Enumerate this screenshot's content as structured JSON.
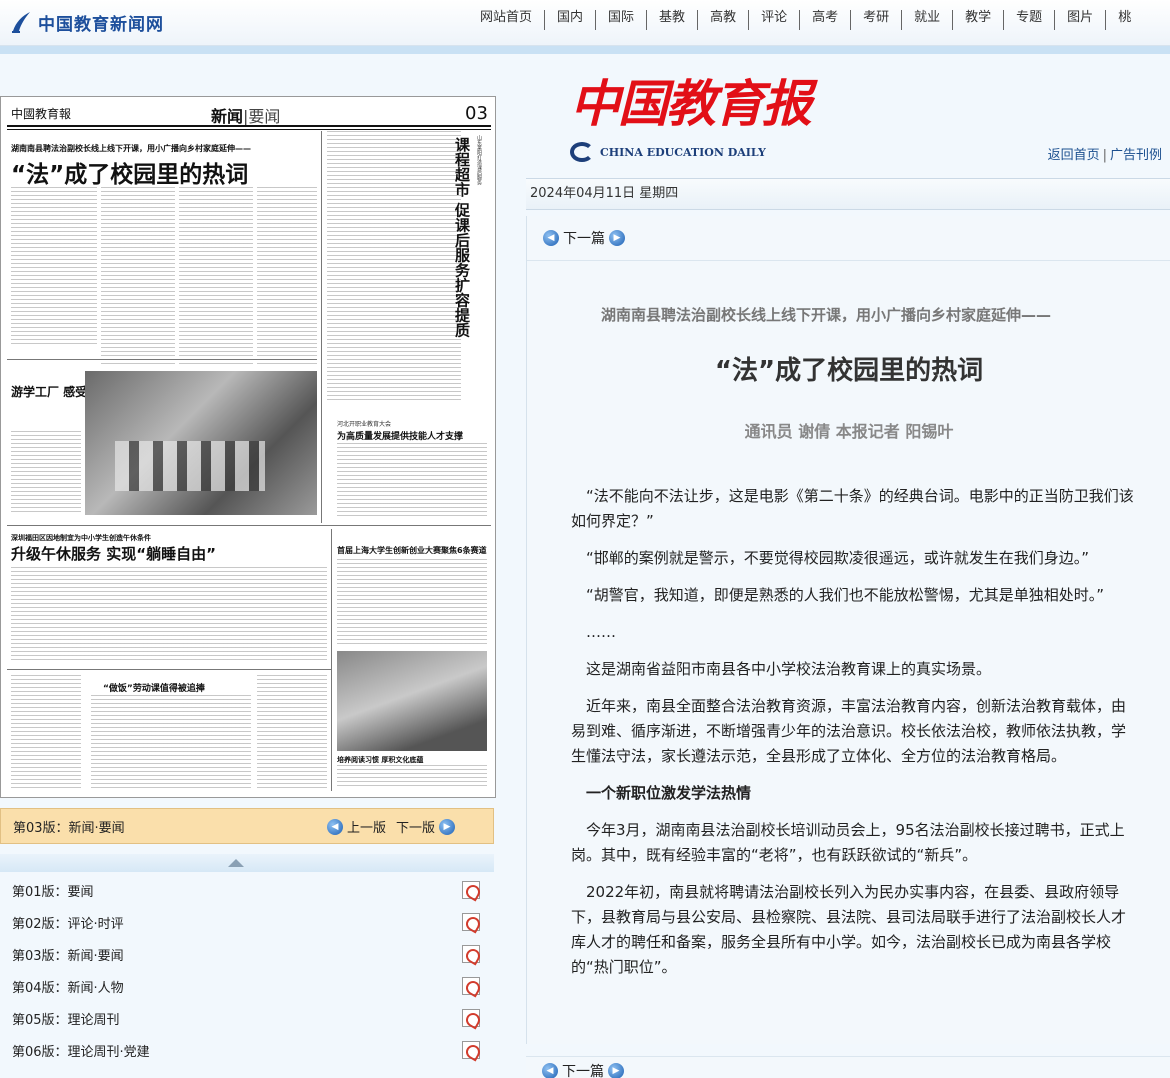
{
  "site": {
    "logo_text": "中国教育新闻网",
    "nav": [
      "网站首页",
      "国内",
      "国际",
      "基教",
      "高教",
      "评论",
      "高考",
      "考研",
      "就业",
      "教学",
      "专题",
      "图片",
      "桃"
    ]
  },
  "masthead": {
    "title": "中国教育报",
    "english": "CHINA EDUCATION DAILY",
    "links": [
      "返回首页",
      "广告刊例"
    ]
  },
  "date": "2024年04月11日 星期四",
  "page_preview": {
    "paper_name": "中國教育報",
    "section": "新闻",
    "section_sub": "要闻",
    "page_number": "03",
    "main_sub": "湖南南县聘法治副校长线上线下开课，用小广播向乡村家庭延伸——",
    "main_head": "“法”成了校园里的热词",
    "vertical_head": "课程超市 促课后服务扩容提质",
    "vertical_small": "山东莱阳打造课后服务",
    "side_head": "游学工厂 感受“智”造",
    "right1_small": "河北开职业教育大会",
    "right1": "为高质量发展提供技能人才支撑",
    "left2_sub": "深圳福田区因地制宜为中小学生创造午休条件",
    "left2": "升级午休服务 实现“躺睡自由”",
    "right2": "首届上海大学生创新创业大赛聚焦6条赛道",
    "mid3": "“做饭”劳动课值得被追捧",
    "right3": "培养阅读习惯 厚积文化底蕴"
  },
  "current_edition": {
    "label": "第03版：",
    "name": "新闻·要闻",
    "prev": "上一版",
    "next": "下一版"
  },
  "editions": [
    {
      "num": "第01版：",
      "name": "要闻"
    },
    {
      "num": "第02版：",
      "name": "评论·时评"
    },
    {
      "num": "第03版：",
      "name": "新闻·要闻"
    },
    {
      "num": "第04版：",
      "name": "新闻·人物"
    },
    {
      "num": "第05版：",
      "name": "理论周刊"
    },
    {
      "num": "第06版：",
      "name": "理论周刊·党建"
    }
  ],
  "article": {
    "next_label": "下一篇",
    "subtitle": "湖南南县聘法治副校长线上线下开课，用小广播向乡村家庭延伸——",
    "title": "“法”成了校园里的热词",
    "byline": "通讯员 谢倩 本报记者 阳锡叶",
    "paragraphs": [
      "“法不能向不法让步，这是电影《第二十条》的经典台词。电影中的正当防卫我们该如何界定？”",
      "“邯郸的案例就是警示，不要觉得校园欺凌很遥远，或许就发生在我们身边。”",
      "“胡警官，我知道，即便是熟悉的人我们也不能放松警惕，尤其是单独相处时。”",
      "……",
      "这是湖南省益阳市南县各中小学校法治教育课上的真实场景。",
      "近年来，南县全面整合法治教育资源，丰富法治教育内容，创新法治教育载体，由易到难、循序渐进，不断增强青少年的法治意识。校长依法治校，教师依法执教，学生懂法守法，家长遵法示范，全县形成了立体化、全方位的法治教育格局。",
      "一个新职位激发学法热情",
      "今年3月，湖南南县法治副校长培训动员会上，95名法治副校长接过聘书，正式上岗。其中，既有经验丰富的“老将”，也有跃跃欲试的“新兵”。",
      "2022年初，南县就将聘请法治副校长列入为民办实事内容，在县委、县政府领导下，县教育局与县公安局、县检察院、县法院、县司法局联手进行了法治副校长人才库人才的聘任和备案，服务全县所有中小学。如今，法治副校长已成为南县各学校的“热门职位”。"
    ]
  }
}
